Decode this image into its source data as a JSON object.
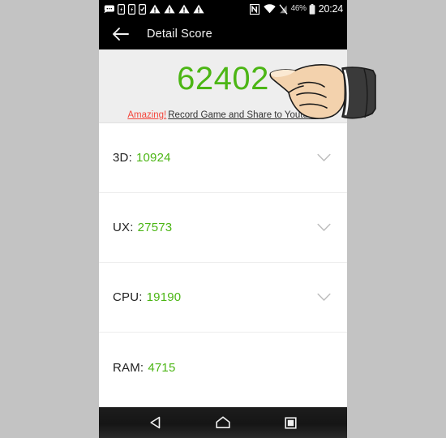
{
  "status_bar": {
    "icons": [
      {
        "name": "sms-message-icon"
      },
      {
        "name": "sim-card-1-icon"
      },
      {
        "name": "sim-card-2-icon"
      },
      {
        "name": "sim-card-3-icon"
      },
      {
        "name": "warning-triangle-1-icon"
      },
      {
        "name": "warning-triangle-2-icon"
      },
      {
        "name": "warning-triangle-3-icon"
      },
      {
        "name": "warning-triangle-4-icon"
      },
      {
        "name": "nfc-icon"
      },
      {
        "name": "wifi-icon"
      },
      {
        "name": "no-signal-icon"
      }
    ],
    "battery_percent": "46%",
    "clock": "20:24"
  },
  "app_bar": {
    "back_icon": "back-arrow-icon",
    "title": "Detail Score"
  },
  "score_header": {
    "total_score": "62402",
    "promo_highlight": "Amazing!",
    "promo_text": "Record Game and Share to Youtube"
  },
  "score_list": {
    "rows": [
      {
        "label": "3D:",
        "value": "10924",
        "has_chevron": true
      },
      {
        "label": "UX:",
        "value": "27573",
        "has_chevron": true
      },
      {
        "label": "CPU:",
        "value": "19190",
        "has_chevron": true
      },
      {
        "label": "RAM:",
        "value": "4715",
        "has_chevron": false
      }
    ]
  },
  "nav_bar": {
    "back": "nav-back-icon",
    "home": "nav-home-icon",
    "recents": "nav-recents-icon"
  },
  "cursor": {
    "name": "pointing-hand-cursor"
  },
  "colors": {
    "accent_green": "#4cb615",
    "promo_red": "#f4463c",
    "header_bg": "#eeeeee",
    "bar_black": "#000000",
    "page_bg": "#c3c3c3"
  }
}
